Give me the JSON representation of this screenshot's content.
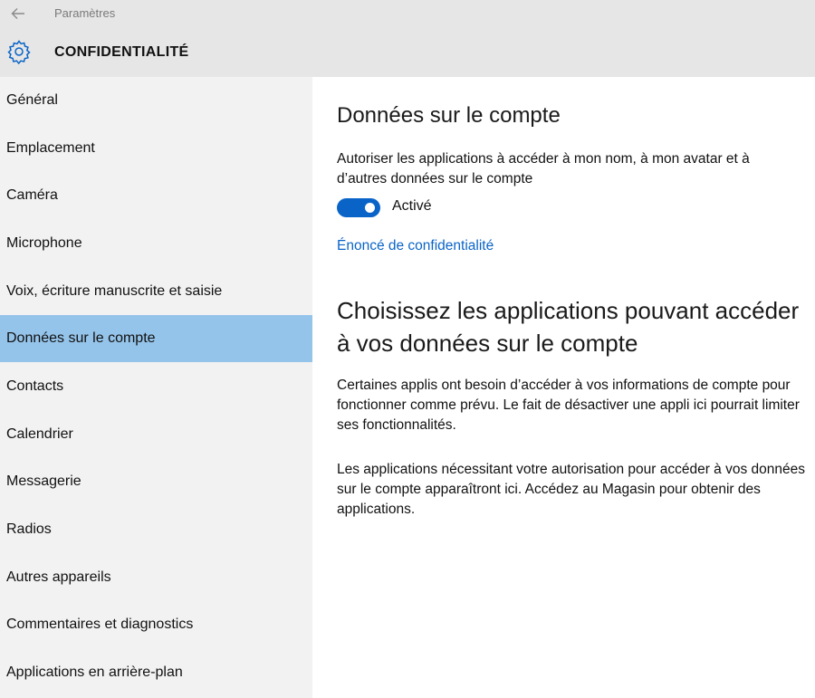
{
  "window": {
    "app_title": "Paramètres",
    "back_icon": "back-arrow-icon"
  },
  "header": {
    "title": "CONFIDENTIALITÉ",
    "icon": "gear-icon",
    "accent": "#0a64c8"
  },
  "sidebar": {
    "items": [
      {
        "label": "Général"
      },
      {
        "label": "Emplacement"
      },
      {
        "label": "Caméra"
      },
      {
        "label": "Microphone"
      },
      {
        "label": "Voix, écriture manuscrite et saisie"
      },
      {
        "label": "Données sur le compte"
      },
      {
        "label": "Contacts"
      },
      {
        "label": "Calendrier"
      },
      {
        "label": "Messagerie"
      },
      {
        "label": "Radios"
      },
      {
        "label": "Autres appareils"
      },
      {
        "label": "Commentaires et diagnostics"
      },
      {
        "label": "Applications en arrière-plan"
      }
    ],
    "selected_label": "Données sur le compte",
    "selected_color": "#95c4ea"
  },
  "main": {
    "heading": "Données sur le compte",
    "description": "Autoriser les applications à accéder à mon nom, à mon avatar et à d’autres données sur le compte",
    "toggle": {
      "state": "on",
      "label": "Activé",
      "color": "#0a64c8"
    },
    "privacy_link": "Énoncé de confidentialité",
    "apps_heading": "Choisissez les applications pouvant accéder à vos données sur le compte",
    "para1": "Certaines applis ont besoin d’accéder à vos informations de compte pour fonctionner comme prévu. Le fait de désactiver une appli ici pourrait limiter ses fonctionnalités.",
    "para2": "Les applications nécessitant votre autorisation pour accéder à vos données sur le compte apparaîtront ici. Accédez au Magasin pour obtenir des applications."
  }
}
